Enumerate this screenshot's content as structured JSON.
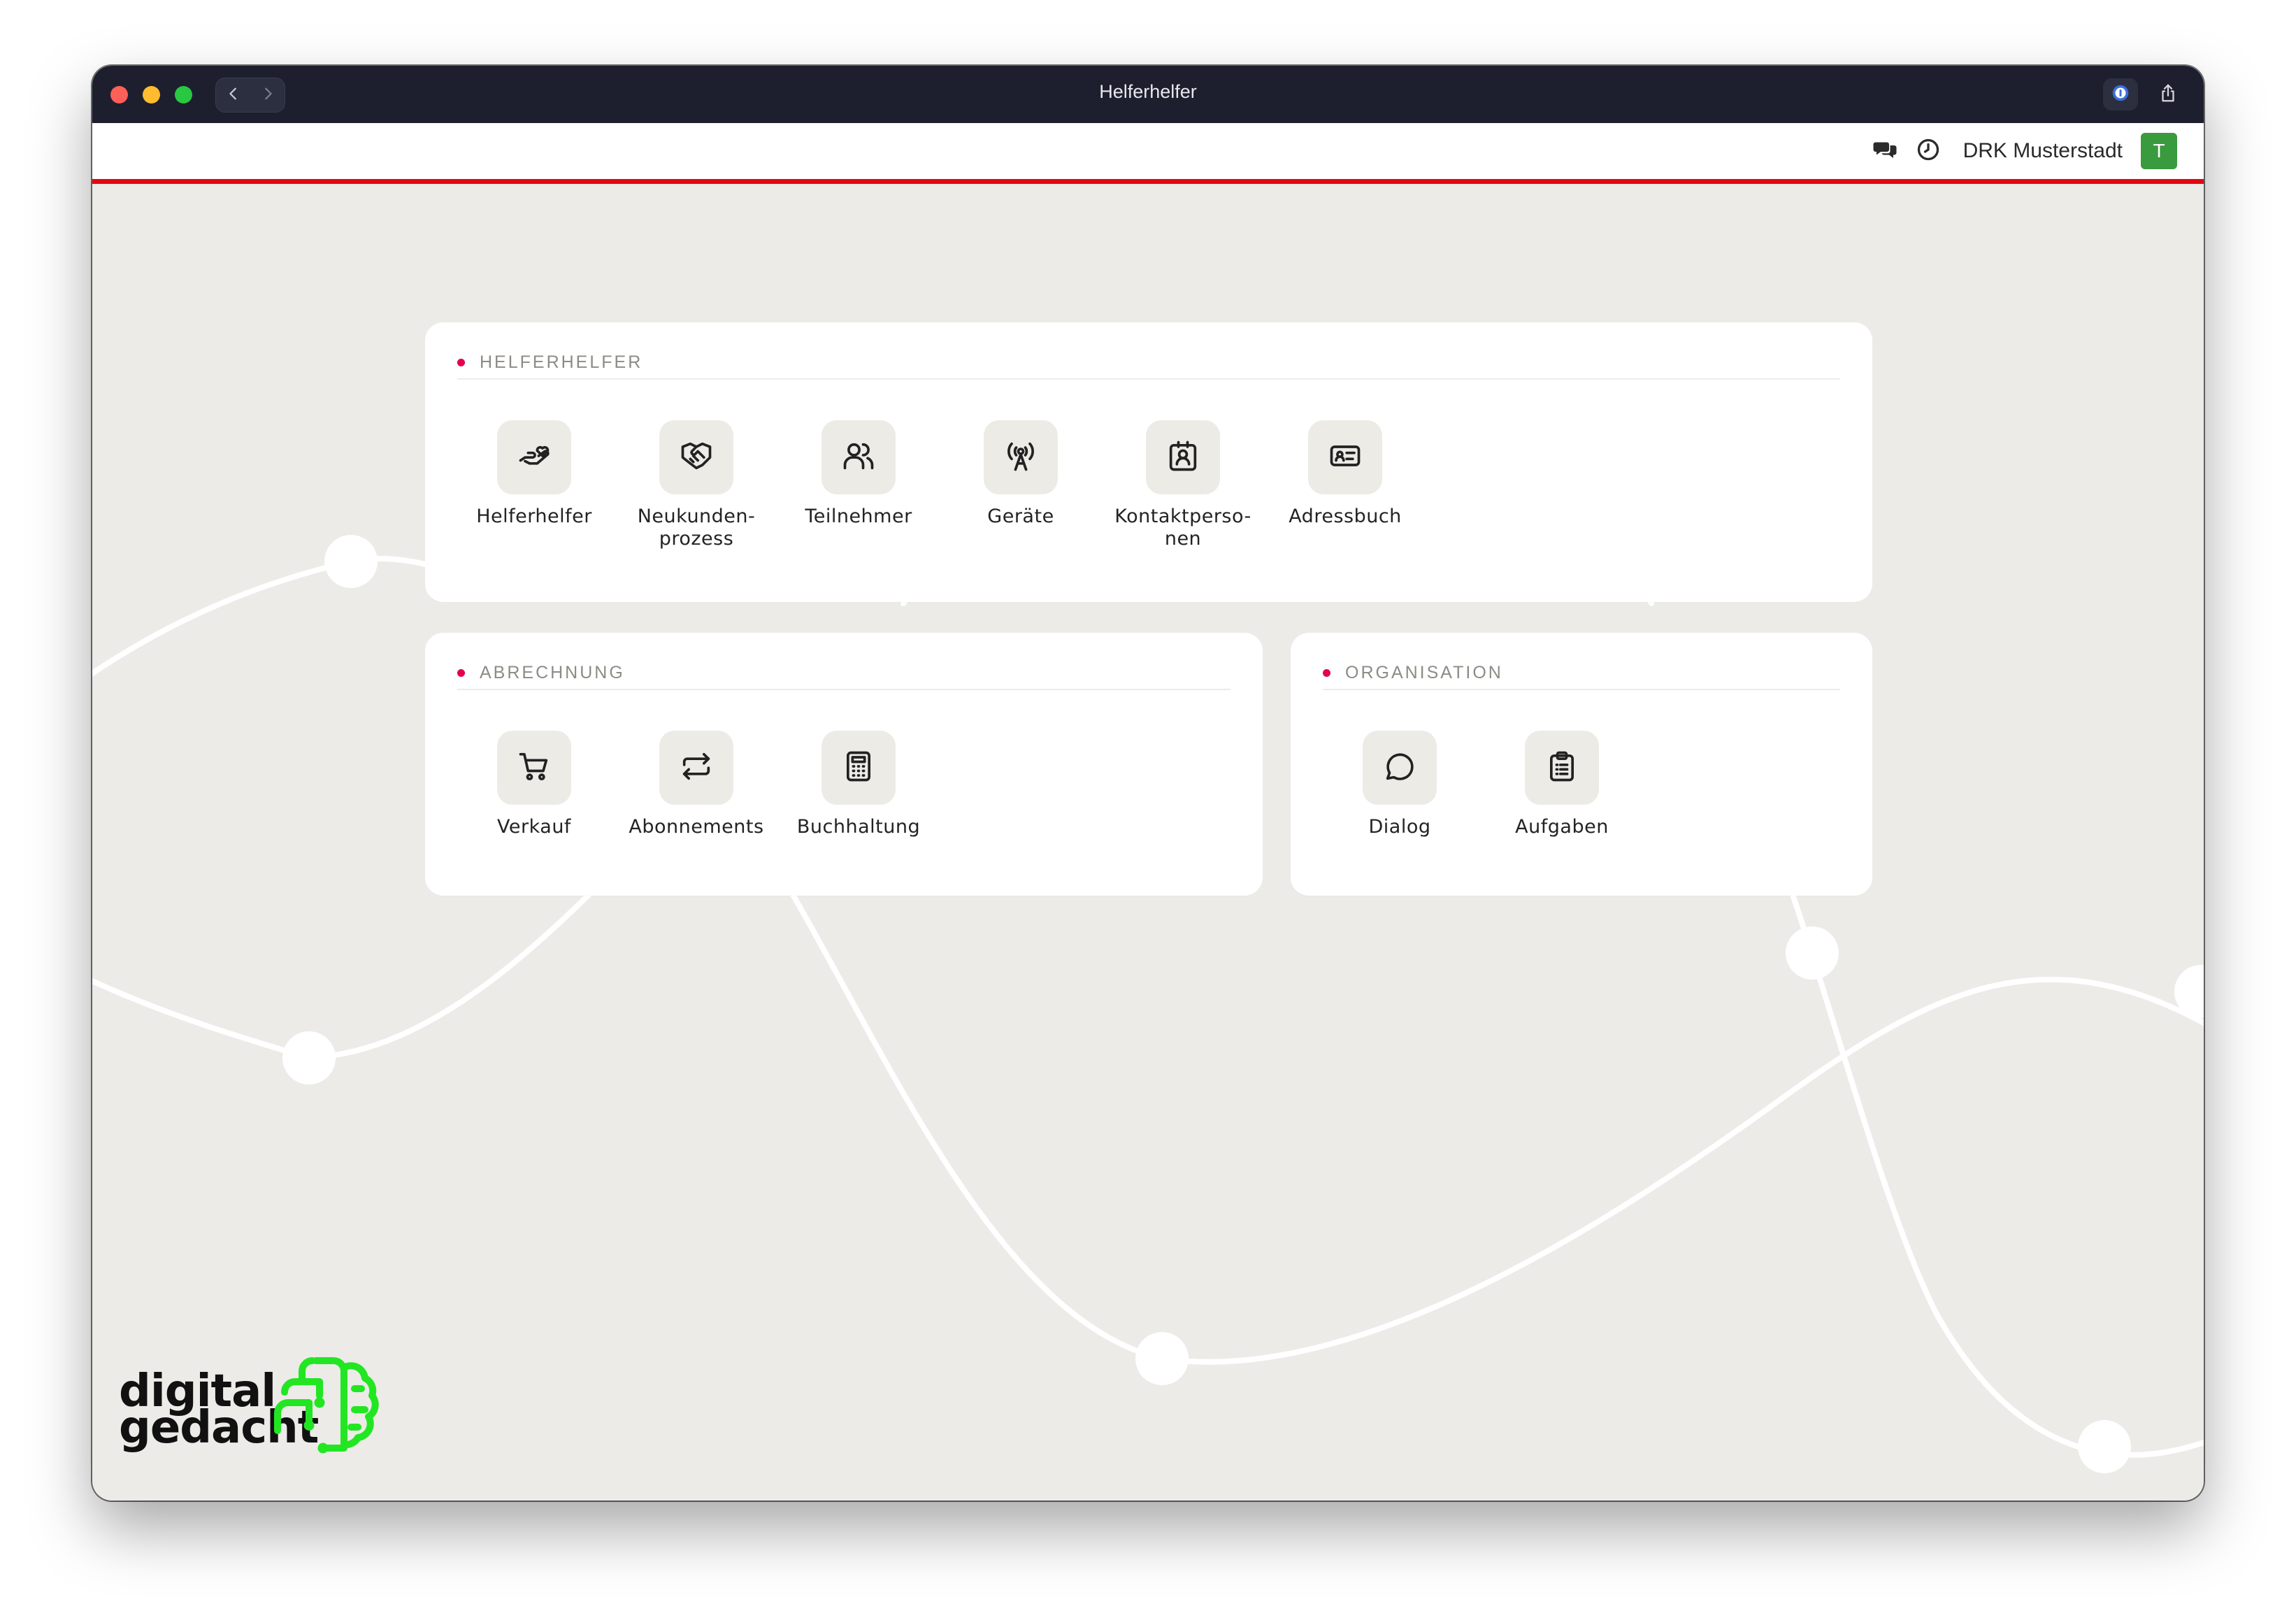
{
  "window": {
    "title": "Helferhelfer"
  },
  "header": {
    "org_name": "DRK Musterstadt",
    "avatar_initial": "T"
  },
  "sections": {
    "helferhelfer": {
      "title": "HELFERHELFER",
      "tiles": [
        {
          "label": "Helferhelfer",
          "icon": "helping-hand-icon"
        },
        {
          "label": "Neukunden-\nprozess",
          "icon": "handshake-icon"
        },
        {
          "label": "Teilnehmer",
          "icon": "users-icon"
        },
        {
          "label": "Geräte",
          "icon": "antenna-icon"
        },
        {
          "label": "Kontaktperso-\nnen",
          "icon": "contact-badge-icon"
        },
        {
          "label": "Adressbuch",
          "icon": "id-card-icon"
        }
      ]
    },
    "abrechnung": {
      "title": "ABRECHNUNG",
      "tiles": [
        {
          "label": "Verkauf",
          "icon": "cart-icon"
        },
        {
          "label": "Abonnements",
          "icon": "repeat-icon"
        },
        {
          "label": "Buchhaltung",
          "icon": "calculator-icon"
        }
      ]
    },
    "organisation": {
      "title": "ORGANISATION",
      "tiles": [
        {
          "label": "Dialog",
          "icon": "chat-bubble-icon"
        },
        {
          "label": "Aufgaben",
          "icon": "clipboard-icon"
        }
      ]
    }
  },
  "logo": {
    "line1": "digital",
    "line2": "gedacht"
  },
  "colors": {
    "accent_red": "#e30613",
    "dot_pink": "#e5004d",
    "avatar_green": "#3a9a3e",
    "logo_green": "#22e622"
  }
}
